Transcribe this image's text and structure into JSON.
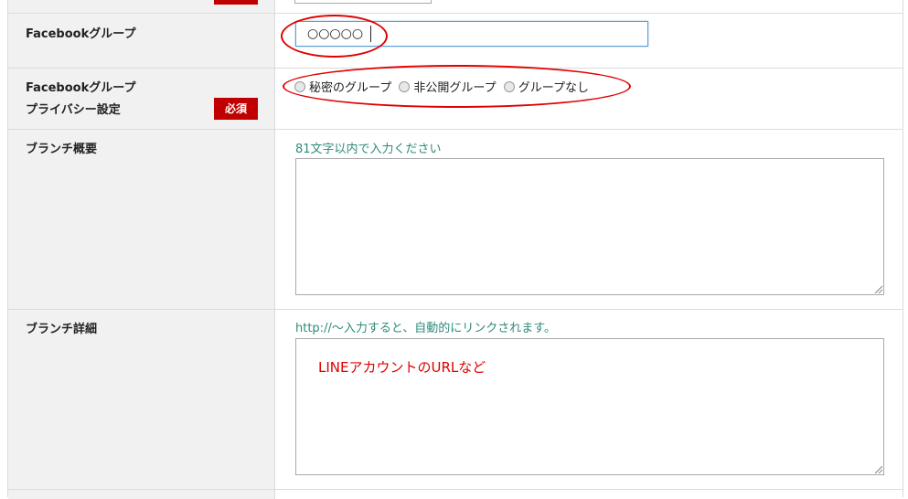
{
  "rows": {
    "facebook_group": {
      "label": "Facebookグループ",
      "value": "○○○○○"
    },
    "privacy": {
      "label_line1": "Facebookグループ",
      "label_line2": "プライバシー設定",
      "required_badge": "必須",
      "options": [
        "秘密のグループ",
        "非公開グループ",
        "グループなし"
      ]
    },
    "branch_summary": {
      "label": "ブランチ概要",
      "help": "81文字以内で入力ください",
      "value": ""
    },
    "branch_detail": {
      "label": "ブランチ詳細",
      "help": "http://～入力すると、自動的にリンクされます。",
      "value": "LINEアカウントのURLなど"
    }
  },
  "colors": {
    "required_bg": "#c00000",
    "help_text": "#2e8b7a",
    "annotation": "#e00000"
  }
}
